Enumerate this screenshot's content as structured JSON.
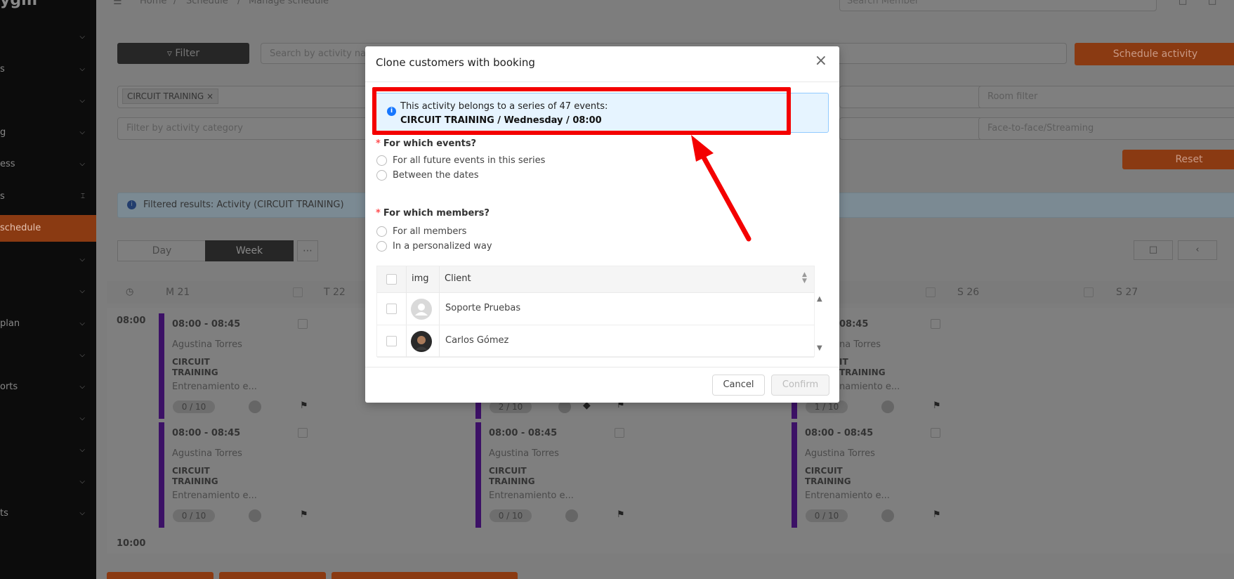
{
  "sidebar": {
    "logo": "ygm",
    "items": [
      {
        "label": "",
        "expanded": false
      },
      {
        "label": "s",
        "expanded": false
      },
      {
        "label": "",
        "expanded": false
      },
      {
        "label": "g",
        "expanded": false
      },
      {
        "label": "ess",
        "expanded": false
      },
      {
        "label": "s",
        "expanded": true
      },
      {
        "label": "schedule",
        "active": true
      },
      {
        "label": "",
        "expanded": false
      },
      {
        "label": "",
        "expanded": false
      },
      {
        "label": "plan",
        "expanded": false
      },
      {
        "label": "",
        "expanded": false
      },
      {
        "label": "orts",
        "expanded": false
      },
      {
        "label": "",
        "expanded": false
      },
      {
        "label": "",
        "expanded": false
      },
      {
        "label": "",
        "expanded": false
      },
      {
        "label": "ts",
        "expanded": false
      }
    ]
  },
  "breadcrumb": [
    "Home",
    "/",
    "Schedule",
    "/",
    "Manage schedule"
  ],
  "header": {
    "search_member_placeholder": "Search Member"
  },
  "toolbar": {
    "filter_label": "Filter",
    "search_placeholder": "Search by activity na",
    "schedule_activity_label": "Schedule activity",
    "activity_tag": "CIRCUIT TRAINING",
    "category_placeholder": "Filter by activity category",
    "room_placeholder": "Room filter",
    "mode_placeholder": "Face-to-face/Streaming",
    "reset_label": "Reset",
    "filtered_results": "Filtered results: Activity (CIRCUIT TRAINING)"
  },
  "view_tabs": {
    "day": "Day",
    "week": "Week",
    "more": "⋯"
  },
  "calendar": {
    "days": [
      "M 21",
      "T 22",
      "S 26",
      "S 27"
    ],
    "times": [
      "08:00",
      "10:00"
    ],
    "events": [
      {
        "time": "08:00 - 08:45",
        "instructor": "Agustina Torres",
        "name": "CIRCUIT TRAINING",
        "desc": "Entrenamiento e...",
        "capacity": "0 / 10"
      },
      {
        "time": "08:00 - 08:45",
        "instructor": "Agustina Torres",
        "name": "CIRCUIT TRAINING",
        "desc": "Entrenamiento e...",
        "capacity": "0 / 10"
      },
      {
        "time": "08:00 - 08:45",
        "instructor": "Agustina Torres",
        "name": "CIRCUIT TRAINING",
        "desc": "Entrenamiento e...",
        "capacity": "0 / 10"
      },
      {
        "time": "08:00 - 08:45",
        "instructor": "Agustina Torres",
        "name": "CIRCUIT TRAINING",
        "desc": "Entrenamiento e...",
        "capacity": "0 / 10"
      },
      {
        "time": "08:45",
        "instructor": "na Torres",
        "name": "IT TRAINING",
        "desc": "namiento e...",
        "capacity": "1 / 10"
      },
      {
        "time": "",
        "instructor": "",
        "name": "",
        "desc": "",
        "capacity": "2 / 10"
      }
    ]
  },
  "modal": {
    "title": "Clone customers with booking",
    "alert_line1": "This activity belongs to a series of 47 events:",
    "alert_line2": "CIRCUIT TRAINING / Wednesday / 08:00",
    "q_events": "For which events?",
    "opt_future": "For all future events in this series",
    "opt_between": "Between the dates",
    "q_members": "For which members?",
    "opt_all_members": "For all members",
    "opt_personalized": "In a personalized way",
    "table": {
      "col_img": "img",
      "col_client": "Client",
      "rows": [
        "Soporte Pruebas",
        "Carlos Gómez"
      ]
    },
    "cancel_label": "Cancel",
    "confirm_label": "Confirm"
  },
  "annotation_color": "#f40000",
  "accent_color": "#d35400"
}
